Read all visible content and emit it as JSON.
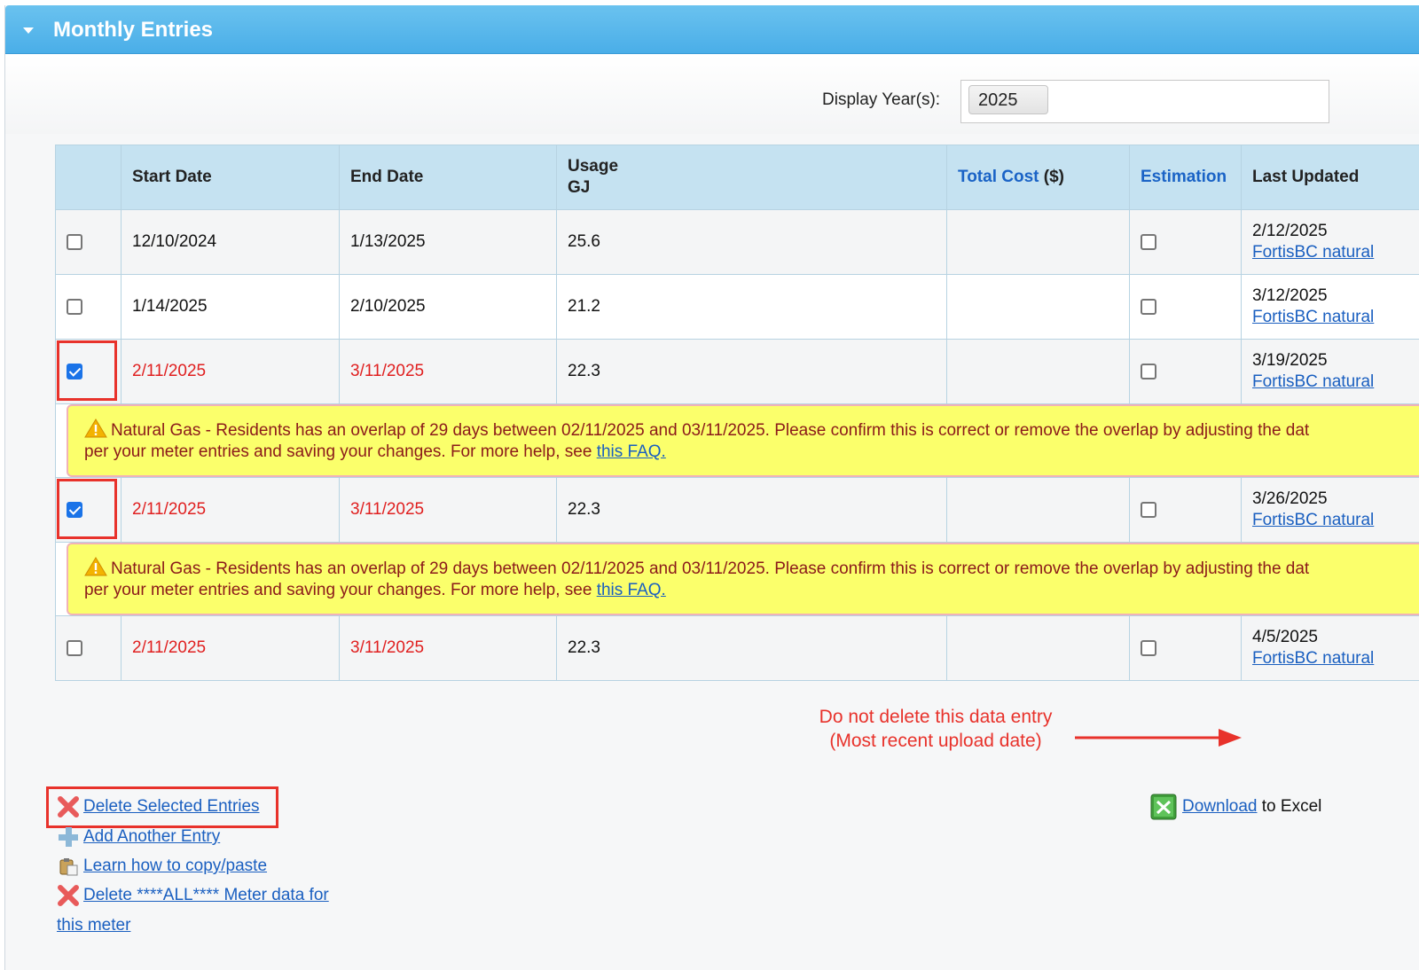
{
  "panel": {
    "title": "Monthly Entries"
  },
  "year_filter": {
    "label": "Display Year(s):",
    "selected": "2025"
  },
  "table": {
    "headers": {
      "start": "Start Date",
      "end": "End Date",
      "usage_line1": "Usage",
      "usage_line2": "GJ",
      "total_cost_link": "Total Cost",
      "total_cost_unit": " ($)",
      "estimation": "Estimation",
      "last_updated": "Last Updated"
    },
    "rows": [
      {
        "checked": false,
        "start": "12/10/2024",
        "end": "1/13/2025",
        "usage": "25.6",
        "total_cost": "",
        "estimation": false,
        "updated_date": "2/12/2025",
        "updated_source": "FortisBC natural"
      },
      {
        "checked": false,
        "start": "1/14/2025",
        "end": "2/10/2025",
        "usage": "21.2",
        "total_cost": "",
        "estimation": false,
        "updated_date": "3/12/2025",
        "updated_source": "FortisBC natural"
      },
      {
        "checked": true,
        "start": "2/11/2025",
        "end": "3/11/2025",
        "usage": "22.3",
        "total_cost": "",
        "estimation": false,
        "updated_date": "3/19/2025",
        "updated_source": "FortisBC natural"
      },
      {
        "checked": true,
        "start": "2/11/2025",
        "end": "3/11/2025",
        "usage": "22.3",
        "total_cost": "",
        "estimation": false,
        "updated_date": "3/26/2025",
        "updated_source": "FortisBC natural"
      },
      {
        "checked": false,
        "start": "2/11/2025",
        "end": "3/11/2025",
        "usage": "22.3",
        "total_cost": "",
        "estimation": false,
        "updated_date": "4/5/2025",
        "updated_source": "FortisBC natural"
      }
    ],
    "warning": {
      "line1": "Natural Gas - Residents has an overlap of 29 days between 02/11/2025 and 03/11/2025. Please confirm this is correct or remove the overlap by adjusting the dat",
      "line2": "per your meter entries and saving your changes. For more help, see ",
      "link": "this FAQ."
    }
  },
  "annotation": {
    "line1": "Do not delete this data entry",
    "line2": "(Most recent upload date)"
  },
  "actions": {
    "delete_selected": "Delete Selected Entries",
    "add_another": "Add Another Entry",
    "learn_copy": "Learn how to copy/paste",
    "delete_all_line1": "Delete ****ALL**** Meter data for",
    "delete_all_line2": "this meter"
  },
  "download": {
    "link": "Download",
    "suffix": " to Excel"
  },
  "colors": {
    "header_blue": "#4aaee8",
    "annotation_red": "#e8322b",
    "warning_yellow": "#fbff6b",
    "link_blue": "#1a5fc0"
  }
}
